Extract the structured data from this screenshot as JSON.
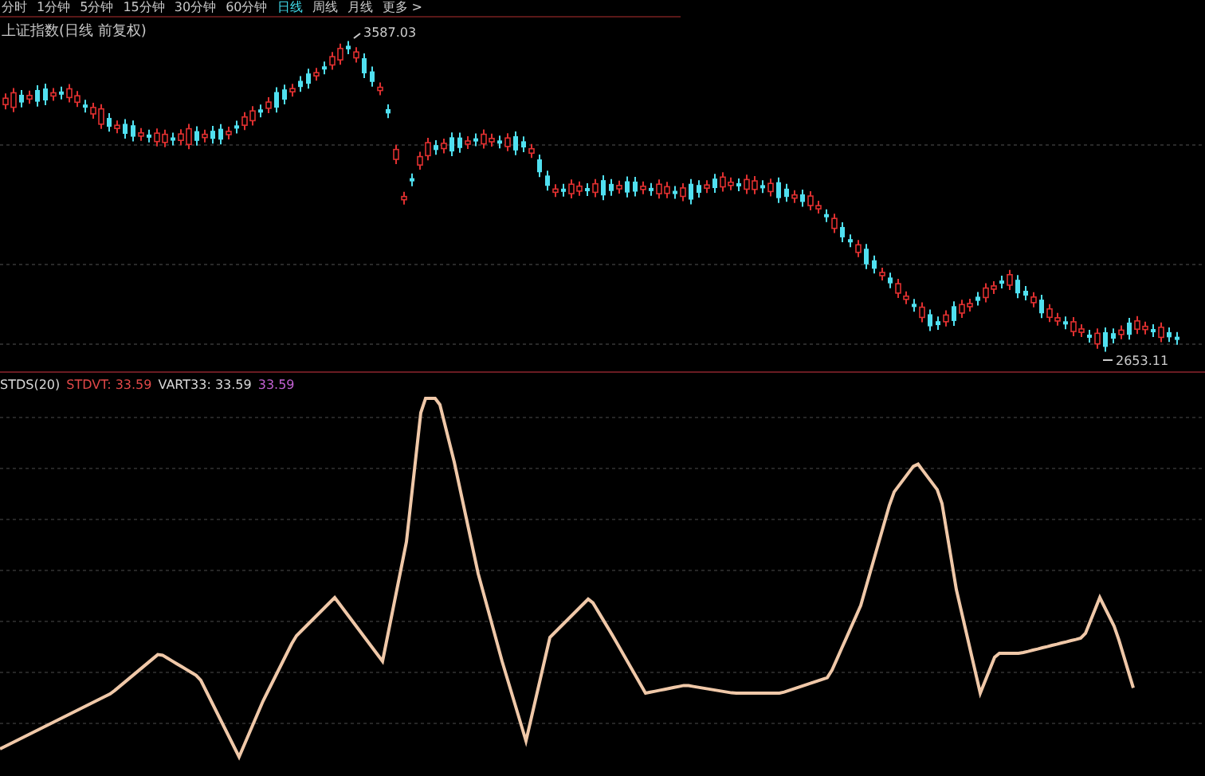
{
  "periods": [
    {
      "label": "分时",
      "selected": false
    },
    {
      "label": "1分钟",
      "selected": false
    },
    {
      "label": "5分钟",
      "selected": false
    },
    {
      "label": "15分钟",
      "selected": false
    },
    {
      "label": "30分钟",
      "selected": false
    },
    {
      "label": "60分钟",
      "selected": false
    },
    {
      "label": "日线",
      "selected": true
    },
    {
      "label": "周线",
      "selected": false
    },
    {
      "label": "月线",
      "selected": false
    },
    {
      "label": "更多 >",
      "selected": false
    }
  ],
  "price_chart": {
    "title": "上证指数(日线 前复权)",
    "high_label": "3587.03",
    "low_label": "2653.11"
  },
  "indicator": {
    "legend": [
      {
        "text": "STDS(20)",
        "color": "#d8d8d8"
      },
      {
        "text": "STDVT: 33.59",
        "color": "#e04848"
      },
      {
        "text": "VART33: 33.59",
        "color": "#d8d8d8"
      },
      {
        "text": "33.59",
        "color": "#c060d0"
      }
    ]
  }
}
